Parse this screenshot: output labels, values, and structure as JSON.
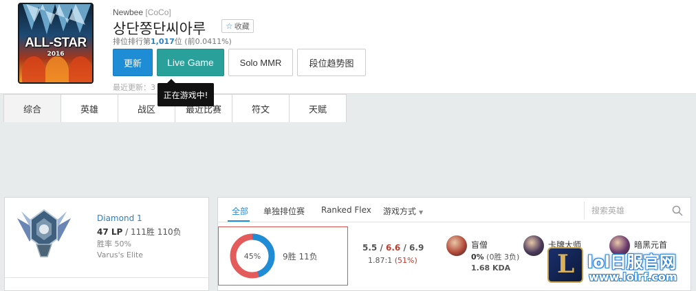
{
  "profile": {
    "emblem_title": "ALL-STAR",
    "emblem_year": "2016",
    "server_text": "Newbee",
    "server_tag": "[CoCo]",
    "summoner_name": "상단쫑단씨아루",
    "favorite_label": "收藏",
    "rank_prefix": "排位排行第",
    "rank_number": "1,017",
    "rank_suffix": "位 (前0.0411%)",
    "last_update": "最近更新：3"
  },
  "buttons": {
    "update": "更新",
    "live_game": "Live Game",
    "solo_mmr": "Solo MMR",
    "trend": "段位趋势图"
  },
  "tooltip": "正在游戏中!",
  "tabs": [
    "综合",
    "英雄",
    "战区",
    "最近比赛",
    "符文",
    "天赋"
  ],
  "rank_card": {
    "tier": "Diamond 1",
    "lp": "47 LP",
    "record": " / 111胜 110负",
    "winrate": "胜率 50%",
    "league": "Varus's Elite"
  },
  "filters": {
    "all": "全部",
    "solo": "单独排位赛",
    "flex": "Ranked Flex",
    "mode": "游戏方式",
    "search_placeholder": "搜索英雄"
  },
  "summary": {
    "win_percent": 45,
    "win_label": "45%",
    "record": "9胜 11负",
    "kills": "5.5",
    "deaths": "6.6",
    "assists": "6.9",
    "ratio": "1.87:1",
    "kill_participation": "(51%)",
    "colors": {
      "win": "#1f8dd6",
      "loss": "#e35b5b"
    }
  },
  "champions": [
    {
      "name": "盲僧",
      "rate_pct": "0%",
      "record": " (0胜 3负)",
      "kda": "1.68 KDA",
      "avatar_color": "#b34a3a"
    },
    {
      "name": "卡牌大师",
      "rate_pct": "",
      "record": "",
      "kda": "",
      "avatar_color": "#4a3a5c"
    },
    {
      "name": "暗黑元首",
      "rate_pct": "",
      "record": "",
      "kda": "",
      "avatar_color": "#6b3a6e"
    }
  ],
  "watermark": {
    "title": "lol日服官网",
    "url": "www.lolrf.com"
  }
}
